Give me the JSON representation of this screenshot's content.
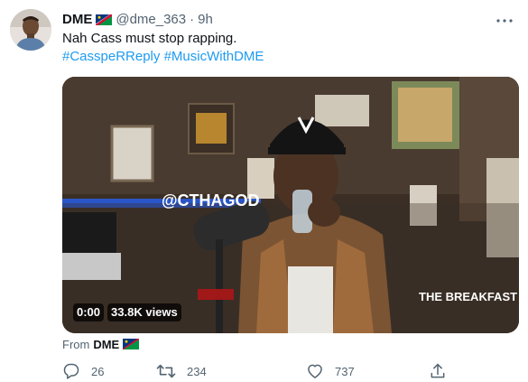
{
  "tweet": {
    "author_name": "DME",
    "author_handle": "@dme_363",
    "separator": "·",
    "time": "9h",
    "text": "Nah Cass must stop rapping.",
    "hashtags": [
      "#CasspeRReply",
      "#MusicWithDME"
    ],
    "media": {
      "video_time": "0:00",
      "view_count": "33.8K views",
      "overlay_text": "@CTHAGOD",
      "watermark": "THE BREAKFAST CLUB"
    },
    "source_prefix": "From",
    "source_name": "DME",
    "actions": {
      "replies": "26",
      "retweets": "234",
      "likes": "737"
    }
  },
  "icons": {
    "more": "more-dots-icon",
    "reply": "reply-icon",
    "retweet": "retweet-icon",
    "like": "heart-icon",
    "share": "share-icon",
    "flag": "namibia-flag-icon"
  },
  "colors": {
    "link": "#1d9bf0",
    "secondary_text": "#536471",
    "primary_text": "#0f1419"
  }
}
